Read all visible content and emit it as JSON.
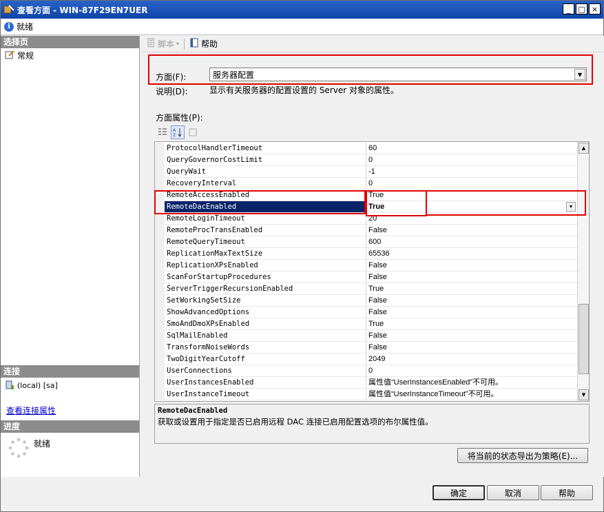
{
  "window": {
    "title": "查看方面 - WIN-87F29EN7UER",
    "buttons": {
      "minimize": "_",
      "maximize": "□",
      "close": "×"
    }
  },
  "status": {
    "text": "就绪"
  },
  "left_panel": {
    "select_page_header": "选择页",
    "pages": [
      {
        "label": "常规"
      }
    ],
    "connection_header": "连接",
    "connection_item": "(local) [sa]",
    "view_connection_link": "查看连接属性",
    "progress_header": "进度",
    "progress_text": "就绪"
  },
  "toolbar": {
    "script_label": "脚本",
    "help_label": "帮助"
  },
  "facet": {
    "label": "方面(F):",
    "value": "服务器配置",
    "description_label": "说明(D):",
    "description": "显示有关服务器的配置设置的 Server 对象的属性。"
  },
  "properties": {
    "label": "方面属性(P):",
    "rows": [
      {
        "name": "ProtocolHandlerTimeout",
        "value": "60"
      },
      {
        "name": "QueryGovernorCostLimit",
        "value": "0"
      },
      {
        "name": "QueryWait",
        "value": "-1"
      },
      {
        "name": "RecoveryInterval",
        "value": "0"
      },
      {
        "name": "RemoteAccessEnabled",
        "value": "True"
      },
      {
        "name": "RemoteDacEnabled",
        "value": "True"
      },
      {
        "name": "RemoteLoginTimeout",
        "value": "20"
      },
      {
        "name": "RemoteProcTransEnabled",
        "value": "False"
      },
      {
        "name": "RemoteQueryTimeout",
        "value": "600"
      },
      {
        "name": "ReplicationMaxTextSize",
        "value": "65536"
      },
      {
        "name": "ReplicationXPsEnabled",
        "value": "False"
      },
      {
        "name": "ScanForStartupProcedures",
        "value": "False"
      },
      {
        "name": "ServerTriggerRecursionEnabled",
        "value": "True"
      },
      {
        "name": "SetWorkingSetSize",
        "value": "False"
      },
      {
        "name": "ShowAdvancedOptions",
        "value": "False"
      },
      {
        "name": "SmoAndDmoXPsEnabled",
        "value": "True"
      },
      {
        "name": "SqlMailEnabled",
        "value": "False"
      },
      {
        "name": "TransformNoiseWords",
        "value": "False"
      },
      {
        "name": "TwoDigitYearCutoff",
        "value": "2049"
      },
      {
        "name": "UserConnections",
        "value": "0"
      },
      {
        "name": "UserInstancesEnabled",
        "value": "属性值“UserInstancesEnabled”不可用。"
      },
      {
        "name": "UserInstanceTimeout",
        "value": "属性值“UserInstanceTimeout”不可用。"
      }
    ],
    "selected_index": 5
  },
  "help_pane": {
    "title": "RemoteDacEnabled",
    "text": "获取或设置用于指定是否已启用远程 DAC 连接已启用配置选项的布尔属性值。"
  },
  "buttons": {
    "export_policy": "将当前的状态导出为策略(E)...",
    "ok": "确定",
    "cancel": "取消",
    "help": "帮助"
  },
  "colors": {
    "title_bar": "#0e44a9",
    "selection": "#0a246a",
    "highlight_box": "#e00000"
  }
}
